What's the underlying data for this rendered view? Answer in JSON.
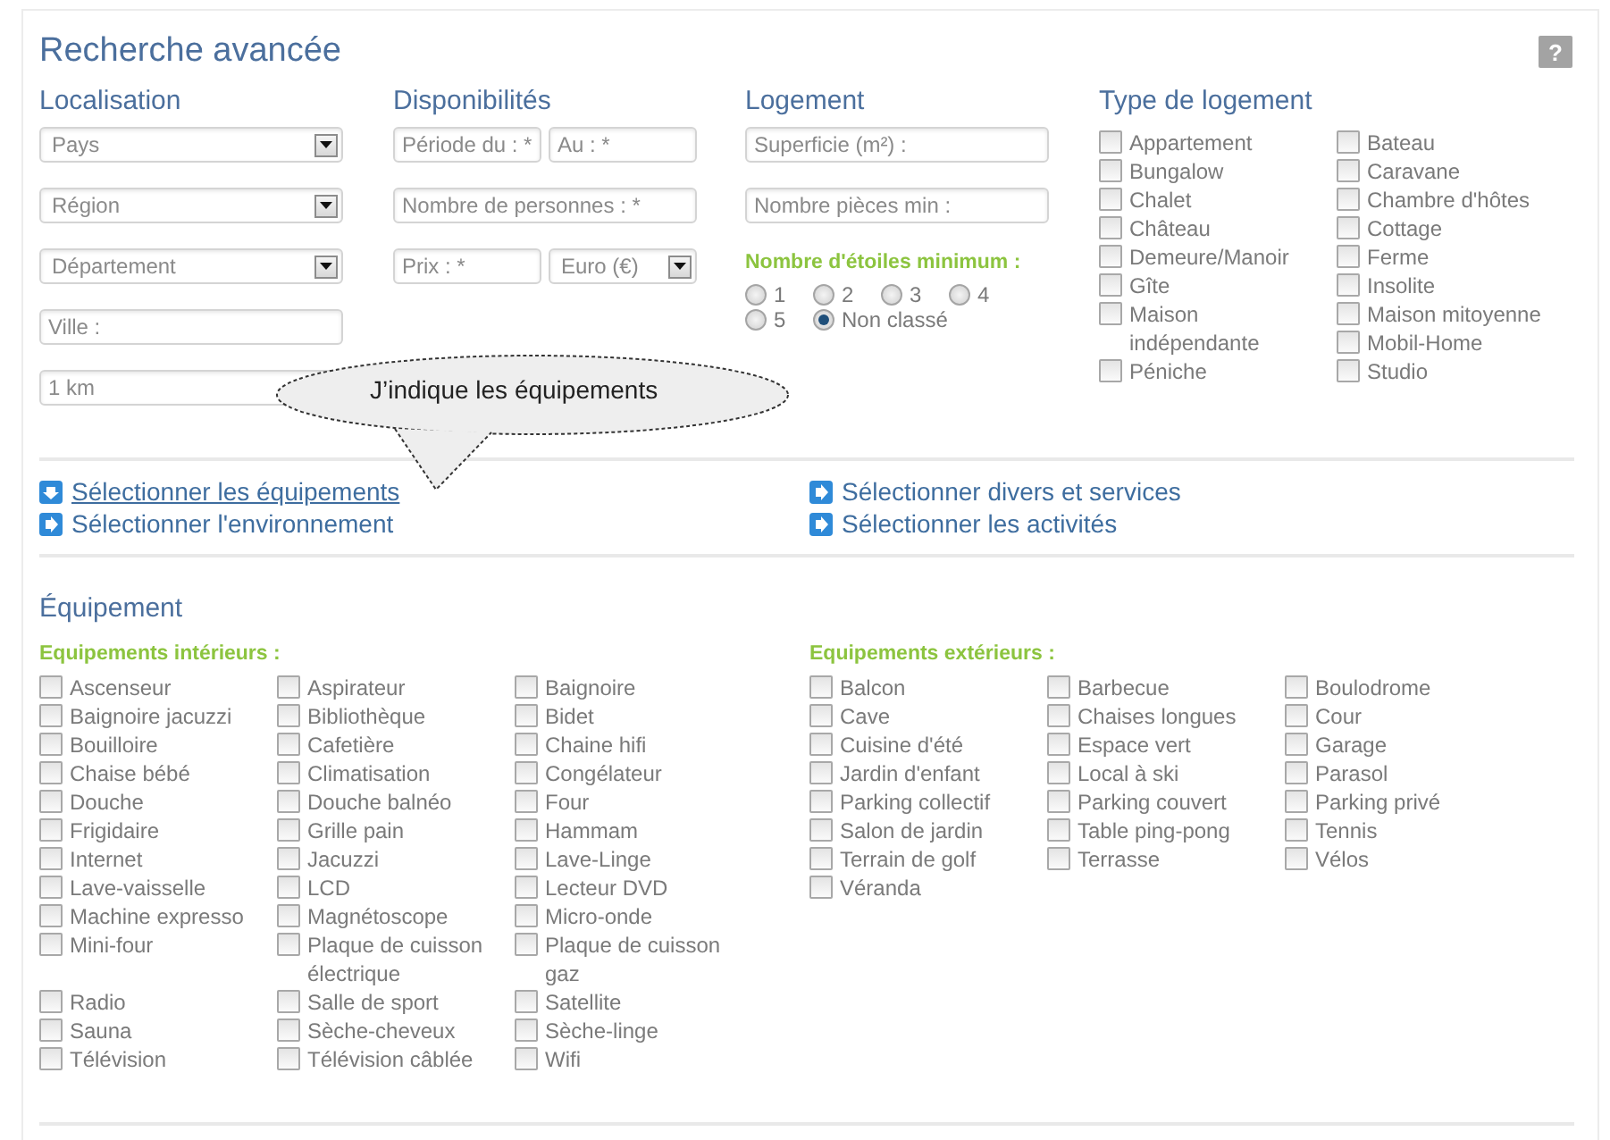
{
  "title": "Recherche avancée",
  "help_button": "?",
  "localisation": {
    "heading": "Localisation",
    "rows": [
      [
        {
          "kind": "select",
          "value": "Pays"
        }
      ],
      [
        {
          "kind": "select",
          "value": "Région"
        }
      ],
      [
        {
          "kind": "select",
          "value": "Département"
        }
      ],
      [
        {
          "kind": "input",
          "placeholder": "Ville :"
        }
      ],
      [
        {
          "kind": "input",
          "value": "1 km"
        }
      ]
    ]
  },
  "disponibilites": {
    "heading": "Disponibilités",
    "rows": [
      [
        {
          "kind": "input",
          "placeholder": "Période du : *"
        },
        {
          "kind": "input",
          "placeholder": "Au : *"
        }
      ],
      [
        {
          "kind": "input",
          "placeholder": "Nombre de personnes : *"
        }
      ],
      [
        {
          "kind": "input",
          "placeholder": "Prix : *"
        },
        {
          "kind": "select",
          "value": "Euro (€)"
        }
      ]
    ]
  },
  "logement": {
    "heading": "Logement",
    "rows": [
      [
        {
          "kind": "input",
          "placeholder": "Superficie (m²) :"
        }
      ],
      [
        {
          "kind": "input",
          "placeholder": "Nombre pièces min :"
        }
      ]
    ],
    "stars_label": "Nombre d'étoiles minimum :",
    "star_options": [
      {
        "label": "1",
        "selected": false
      },
      {
        "label": "2",
        "selected": false
      },
      {
        "label": "3",
        "selected": false
      },
      {
        "label": "4",
        "selected": false
      },
      {
        "label": "5",
        "selected": false
      },
      {
        "label": "Non classé",
        "selected": true
      }
    ]
  },
  "type_logement": {
    "heading": "Type de logement",
    "columns": [
      [
        {
          "label": "Appartement",
          "checked": false
        },
        {
          "label": "Bungalow",
          "checked": false
        },
        {
          "label": "Chalet",
          "checked": false
        },
        {
          "label": "Château",
          "checked": false
        },
        {
          "label": "Demeure/Manoir",
          "checked": false
        },
        {
          "label": "Gîte",
          "checked": false
        },
        {
          "label": "Maison indépendante",
          "checked": false
        },
        {
          "label": "Péniche",
          "checked": false
        }
      ],
      [
        {
          "label": "Bateau",
          "checked": false
        },
        {
          "label": "Caravane",
          "checked": false
        },
        {
          "label": "Chambre d'hôtes",
          "checked": false
        },
        {
          "label": "Cottage",
          "checked": false
        },
        {
          "label": "Ferme",
          "checked": false
        },
        {
          "label": "Insolite",
          "checked": false
        },
        {
          "label": "Maison mitoyenne",
          "checked": false
        },
        {
          "label": "Mobil-Home",
          "checked": false
        },
        {
          "label": "Studio",
          "checked": false
        }
      ]
    ]
  },
  "callout": "J’indique les équipements",
  "links": [
    {
      "label": "Sélectionner les équipements",
      "expanded": true
    },
    {
      "label": "Sélectionner divers et services",
      "expanded": false
    },
    {
      "label": "Sélectionner l'environnement",
      "expanded": false
    },
    {
      "label": "Sélectionner les activités",
      "expanded": false
    }
  ],
  "equipement": {
    "heading": "Équipement",
    "groups": [
      {
        "heading": "Equipements intérieurs :",
        "items": [
          {
            "label": "Ascenseur",
            "checked": false
          },
          {
            "label": "Aspirateur",
            "checked": false
          },
          {
            "label": "Baignoire",
            "checked": false
          },
          {
            "label": "Baignoire jacuzzi",
            "checked": false
          },
          {
            "label": "Bibliothèque",
            "checked": false
          },
          {
            "label": "Bidet",
            "checked": false
          },
          {
            "label": "Bouilloire",
            "checked": false
          },
          {
            "label": "Cafetière",
            "checked": false
          },
          {
            "label": "Chaine hifi",
            "checked": false
          },
          {
            "label": "Chaise bébé",
            "checked": false
          },
          {
            "label": "Climatisation",
            "checked": false
          },
          {
            "label": "Congélateur",
            "checked": false
          },
          {
            "label": "Douche",
            "checked": false
          },
          {
            "label": "Douche balnéo",
            "checked": false
          },
          {
            "label": "Four",
            "checked": false
          },
          {
            "label": "Frigidaire",
            "checked": false
          },
          {
            "label": "Grille pain",
            "checked": false
          },
          {
            "label": "Hammam",
            "checked": false
          },
          {
            "label": "Internet",
            "checked": false
          },
          {
            "label": "Jacuzzi",
            "checked": false
          },
          {
            "label": "Lave-Linge",
            "checked": false
          },
          {
            "label": "Lave-vaisselle",
            "checked": false
          },
          {
            "label": "LCD",
            "checked": false
          },
          {
            "label": "Lecteur DVD",
            "checked": false
          },
          {
            "label": "Machine expresso",
            "checked": false
          },
          {
            "label": "Magnétoscope",
            "checked": false
          },
          {
            "label": "Micro-onde",
            "checked": false
          },
          {
            "label": "Mini-four",
            "checked": false
          },
          {
            "label": "Plaque de cuisson électrique",
            "checked": false
          },
          {
            "label": "Plaque de cuisson gaz",
            "checked": false
          },
          {
            "label": "Radio",
            "checked": false
          },
          {
            "label": "Salle de sport",
            "checked": false
          },
          {
            "label": "Satellite",
            "checked": false
          },
          {
            "label": "Sauna",
            "checked": false
          },
          {
            "label": "Sèche-cheveux",
            "checked": false
          },
          {
            "label": "Sèche-linge",
            "checked": false
          },
          {
            "label": "Télévision",
            "checked": false
          },
          {
            "label": "Télévision câblée",
            "checked": false
          },
          {
            "label": "Wifi",
            "checked": false
          }
        ]
      },
      {
        "heading": "Equipements extérieurs :",
        "items": [
          {
            "label": "Balcon",
            "checked": false
          },
          {
            "label": "Barbecue",
            "checked": false
          },
          {
            "label": "Boulodrome",
            "checked": false
          },
          {
            "label": "Cave",
            "checked": false
          },
          {
            "label": "Chaises longues",
            "checked": false
          },
          {
            "label": "Cour",
            "checked": false
          },
          {
            "label": "Cuisine d'été",
            "checked": false
          },
          {
            "label": "Espace vert",
            "checked": false
          },
          {
            "label": "Garage",
            "checked": false
          },
          {
            "label": "Jardin d'enfant",
            "checked": false
          },
          {
            "label": "Local à ski",
            "checked": false
          },
          {
            "label": "Parasol",
            "checked": false
          },
          {
            "label": "Parking collectif",
            "checked": false
          },
          {
            "label": "Parking couvert",
            "checked": false
          },
          {
            "label": "Parking privé",
            "checked": false
          },
          {
            "label": "Salon de jardin",
            "checked": false
          },
          {
            "label": "Table ping-pong",
            "checked": false
          },
          {
            "label": "Tennis",
            "checked": false
          },
          {
            "label": "Terrain de golf",
            "checked": false
          },
          {
            "label": "Terrasse",
            "checked": false
          },
          {
            "label": "Vélos",
            "checked": false
          },
          {
            "label": "Véranda",
            "checked": false
          }
        ]
      }
    ]
  }
}
